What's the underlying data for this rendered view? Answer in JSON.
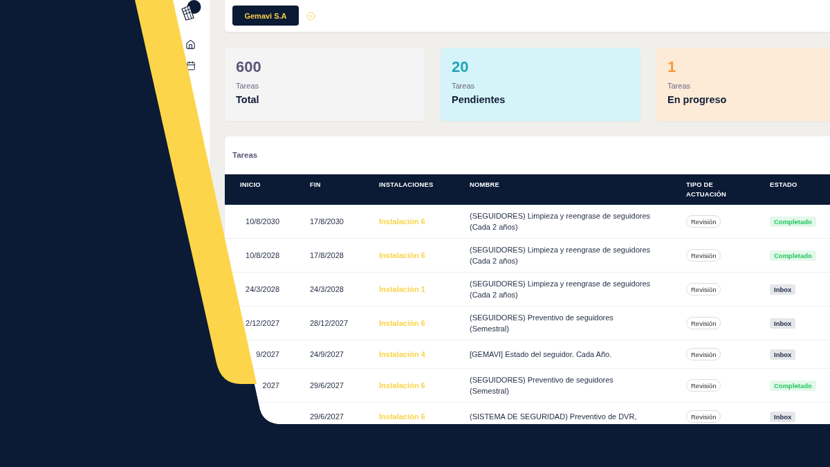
{
  "filter_bar": {
    "company": "Gemavi S.A"
  },
  "stats": [
    {
      "kind": "total",
      "value": "600",
      "caption": "Tareas",
      "label": "Total"
    },
    {
      "kind": "pending",
      "value": "20",
      "caption": "Tareas",
      "label": "Pendientes"
    },
    {
      "kind": "in_progress",
      "value": "1",
      "caption": "Tareas",
      "label": "En progreso"
    }
  ],
  "tasks_table": {
    "title": "Tareas",
    "columns": [
      "INICIO",
      "FIN",
      "INSTALACIONES",
      "NOMBRE",
      "TIPO DE ACTUACIÓN",
      "ESTADO"
    ],
    "rows": [
      {
        "start": "10/8/2030",
        "end": "17/8/2030",
        "installation": "Instalación 6",
        "name": "(SEGUIDORES) Limpieza y reengrase de seguidores (Cada 2 años)",
        "type": "Revisión",
        "status": {
          "label": "Completado",
          "kind": "completed"
        }
      },
      {
        "start": "10/8/2028",
        "end": "17/8/2028",
        "installation": "Instalación 6",
        "name": "(SEGUIDORES) Limpieza y reengrase de seguidores (Cada 2 años)",
        "type": "Revisión",
        "status": {
          "label": "Completado",
          "kind": "completed"
        }
      },
      {
        "start": "24/3/2028",
        "end": "24/3/2028",
        "installation": "Instalación 1",
        "name": "(SEGUIDORES) Limpieza y reengrase de seguidores (Cada 2 años)",
        "type": "Revisión",
        "status": {
          "label": "Inbox",
          "kind": "inbox"
        }
      },
      {
        "start": "2/12/2027",
        "end": "28/12/2027",
        "installation": "Instalación 6",
        "name": "(SEGUIDORES) Preventivo de seguidores (Semestral)",
        "type": "Revisión",
        "status": {
          "label": "Inbox",
          "kind": "inbox"
        }
      },
      {
        "start": "9/2027",
        "end": "24/9/2027",
        "installation": "Instalación 4",
        "name": "[GEMAVI] Estado del seguidor. Cada Año.",
        "type": "Revisión",
        "status": {
          "label": "Inbox",
          "kind": "inbox"
        }
      },
      {
        "start": "2027",
        "end": "29/6/2027",
        "installation": "Instalación 6",
        "name": "(SEGUIDORES) Preventivo de seguidores (Semestral)",
        "type": "Revisión",
        "status": {
          "label": "Completado",
          "kind": "completed"
        }
      },
      {
        "end": "29/6/2027",
        "installation": "Instalación 6",
        "name": "(SISTEMA DE SEGURIDAD) Preventivo de DVR,",
        "type": "Revisión",
        "status": {
          "label": "Inbox",
          "kind": "inbox"
        }
      }
    ]
  }
}
